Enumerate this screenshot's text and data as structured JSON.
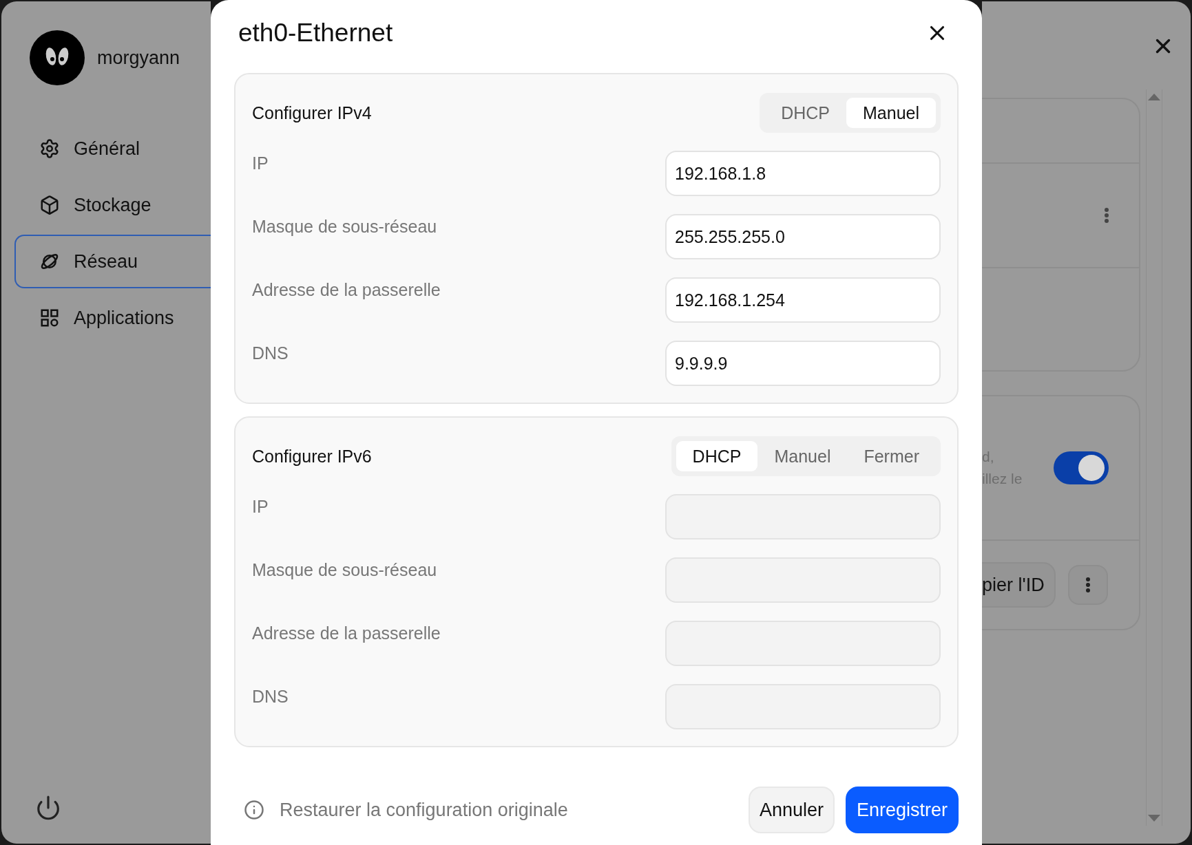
{
  "sidebar": {
    "user": {
      "name": "morgyann"
    },
    "items": [
      {
        "label": "Général",
        "selected": false
      },
      {
        "label": "Stockage",
        "selected": false
      },
      {
        "label": "Réseau",
        "selected": true
      },
      {
        "label": "Applications",
        "selected": false
      }
    ]
  },
  "dialog": {
    "title": "eth0-Ethernet",
    "sections": [
      {
        "title": "Configurer IPv4",
        "modes": [
          {
            "label": "DHCP",
            "selected": false
          },
          {
            "label": "Manuel",
            "selected": true
          }
        ],
        "fields": [
          {
            "label": "IP",
            "value": "192.168.1.8",
            "disabled": false
          },
          {
            "label": "Masque de sous-réseau",
            "value": "255.255.255.0",
            "disabled": false
          },
          {
            "label": "Adresse de la passerelle",
            "value": "192.168.1.254",
            "disabled": false
          },
          {
            "label": "DNS",
            "value": "9.9.9.9",
            "disabled": false
          }
        ]
      },
      {
        "title": "Configurer IPv6",
        "modes": [
          {
            "label": "DHCP",
            "selected": true
          },
          {
            "label": "Manuel",
            "selected": false
          },
          {
            "label": "Fermer",
            "selected": false
          }
        ],
        "fields": [
          {
            "label": "IP",
            "disabled": true
          },
          {
            "label": "Masque de sous-réseau",
            "disabled": true
          },
          {
            "label": "Adresse de la passerelle",
            "disabled": true
          },
          {
            "label": "DNS",
            "disabled": true
          }
        ]
      }
    ],
    "footer": {
      "restore_link": "Restaurer la configuration originale",
      "buttons": [
        {
          "label": "Annuler",
          "kind": "secondary"
        },
        {
          "label": "Enregistrer",
          "kind": "primary"
        }
      ]
    }
  },
  "background": {
    "description_lines": [
      "d,",
      "illez le"
    ],
    "switch": {
      "on": true
    },
    "copy_button": "pier l'ID"
  }
}
